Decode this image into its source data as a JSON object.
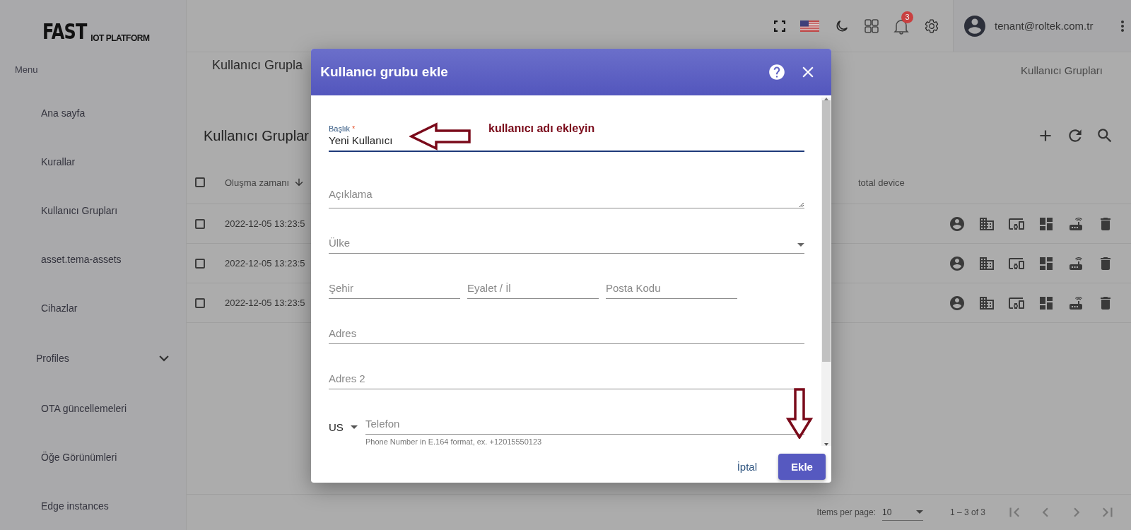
{
  "logo": {
    "main": "FAST",
    "sub": "IOT PLATFORM"
  },
  "sidebar": {
    "heading": "Menu",
    "items": [
      {
        "label": "Ana sayfa",
        "kind": "link"
      },
      {
        "label": "Kurallar",
        "kind": "link"
      },
      {
        "label": "Kullanıcı Grupları",
        "kind": "link"
      },
      {
        "label": "asset.tema-assets",
        "kind": "link"
      },
      {
        "label": "Cihazlar",
        "kind": "link"
      },
      {
        "label": "Profiles",
        "kind": "group",
        "expanded": false
      },
      {
        "label": "OTA güncellemeleri",
        "kind": "link"
      },
      {
        "label": "Öğe Görünümleri",
        "kind": "link"
      },
      {
        "label": "Edge instances",
        "kind": "link"
      }
    ]
  },
  "toolbar": {
    "notification_count": "3",
    "user": "tenant@roltek.com.tr"
  },
  "page": {
    "title": "Kullanıcı Grupla",
    "breadcrumb": "Kullanıcı Grupları"
  },
  "table": {
    "title": "Kullanıcı Gruplar",
    "header_checked": false,
    "columns": [
      "Oluşma zamanı",
      "total device"
    ],
    "rows": [
      {
        "created": "2022-12-05 13:23:5",
        "checked": false
      },
      {
        "created": "2022-12-05 13:23:5",
        "checked": false
      },
      {
        "created": "2022-12-05 13:23:5",
        "checked": false
      }
    ]
  },
  "paginator": {
    "label": "Items per page:",
    "page_size": "10",
    "range": "1 – 3 of 3"
  },
  "dialog": {
    "title": "Kullanıcı grubu ekle",
    "fields": [
      {
        "kind": "text",
        "label": "Başlık",
        "required_mark": "*",
        "value": "Yeni Kullanıcı",
        "focused": true
      },
      {
        "kind": "textarea",
        "placeholder": "Açıklama"
      },
      {
        "kind": "select",
        "placeholder": "Ülke"
      },
      {
        "kind": "row",
        "fields": [
          {
            "kind": "text",
            "placeholder": "Şehir"
          },
          {
            "kind": "text",
            "placeholder": "Eyalet / İl"
          },
          {
            "kind": "text",
            "placeholder": "Posta Kodu"
          }
        ]
      },
      {
        "kind": "text",
        "placeholder": "Adres"
      },
      {
        "kind": "text",
        "placeholder": "Adres 2"
      },
      {
        "kind": "phone",
        "country": "US",
        "placeholder": "Telefon",
        "hint": "Phone Number in E.164 format, ex. +12015550123"
      }
    ],
    "cancel": "İptal",
    "submit": "Ekle"
  },
  "annotation": {
    "text": "kullanıcı adı ekleyin"
  }
}
